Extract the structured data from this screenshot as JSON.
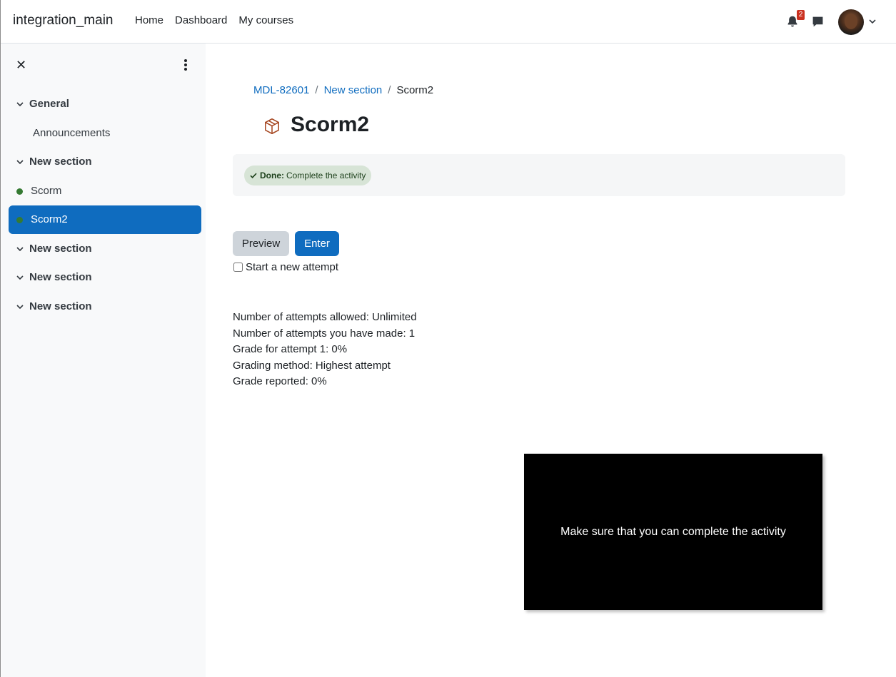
{
  "header": {
    "site_name": "integration_main",
    "nav": [
      "Home",
      "Dashboard",
      "My courses"
    ],
    "notification_count": "2",
    "icons": [
      "bell-icon",
      "chat-icon",
      "avatar",
      "chevron-down-icon"
    ]
  },
  "sidebar": {
    "sections": [
      {
        "label": "General",
        "items": [
          "Announcements"
        ]
      },
      {
        "label": "New section",
        "items": [
          "Scorm",
          "Scorm2"
        ]
      },
      {
        "label": "New section",
        "items": []
      },
      {
        "label": "New section",
        "items": []
      },
      {
        "label": "New section",
        "items": []
      }
    ],
    "active_item": "Scorm2",
    "completion_dot_color": "#357a32",
    "active_color": "#0f6cbf"
  },
  "breadcrumb": [
    "MDL-82601",
    "New section",
    "Scorm2"
  ],
  "page": {
    "title": "Scorm2",
    "completion": {
      "status": "Done:",
      "text": "Complete the activity"
    },
    "preview_label": "Preview",
    "enter_label": "Enter",
    "new_attempt_label": "Start a new attempt",
    "info": [
      "Number of attempts allowed: Unlimited",
      "Number of attempts you have made: 1",
      "Grade for attempt 1: 0%",
      "Grading method: Highest attempt",
      "Grade reported: 0%"
    ]
  },
  "toast": {
    "message": "Make sure that you can complete the activity"
  }
}
